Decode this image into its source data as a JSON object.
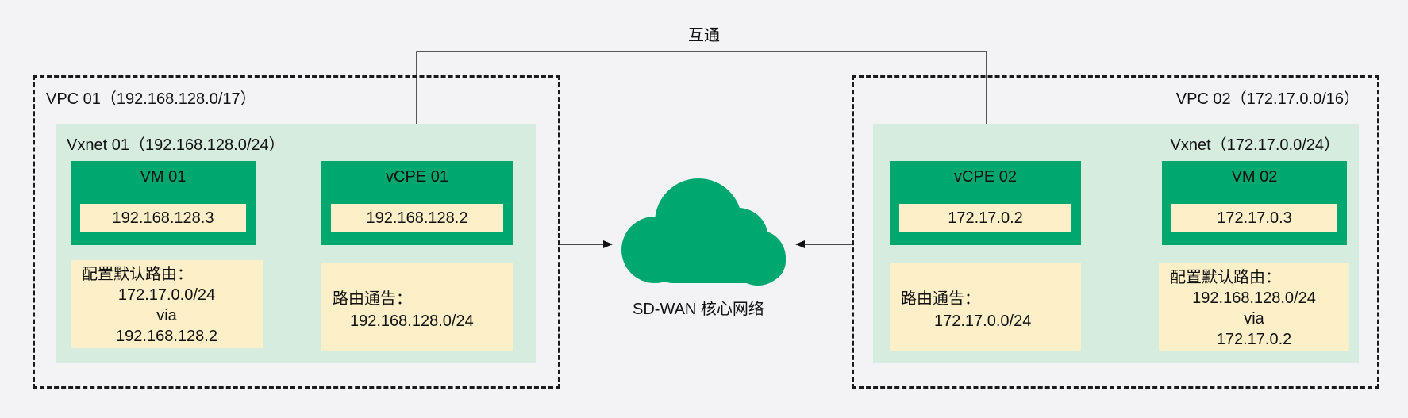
{
  "link_label": "互通",
  "core": {
    "label": "SD-WAN 核心网络",
    "color": "#00a870"
  },
  "vpc1": {
    "label": "VPC 01（192.168.128.0/17）",
    "subnet_label": "Vxnet 01（192.168.128.0/24）",
    "vm": {
      "name": "VM 01",
      "ip": "192.168.128.3"
    },
    "vcpe": {
      "name": "vCPE 01",
      "ip": "192.168.128.2"
    },
    "route_config": {
      "heading": "配置默认路由：",
      "dest": "172.17.0.0/24",
      "via": "via",
      "gateway": "192.168.128.2"
    },
    "route_announce": {
      "heading": "路由通告：",
      "prefix": "192.168.128.0/24"
    }
  },
  "vpc2": {
    "label": "VPC 02（172.17.0.0/16）",
    "subnet_label": "Vxnet（172.17.0.0/24）",
    "vm": {
      "name": "VM 02",
      "ip": "172.17.0.3"
    },
    "vcpe": {
      "name": "vCPE 02",
      "ip": "172.17.0.2"
    },
    "route_config": {
      "heading": "配置默认路由：",
      "dest": "192.168.128.0/24",
      "via": "via",
      "gateway": "172.17.0.2"
    },
    "route_announce": {
      "heading": "路由通告：",
      "prefix": "172.17.0.0/24"
    }
  },
  "colors": {
    "node": "#00a870",
    "subnet": "#d6ecdf",
    "note": "#fdf0c8",
    "background": "#f3f3f5"
  }
}
